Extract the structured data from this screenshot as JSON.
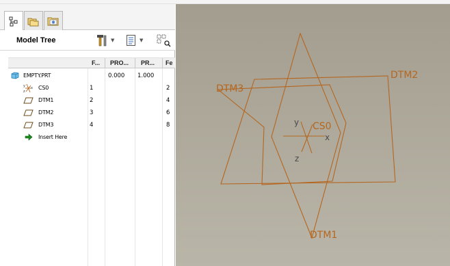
{
  "nav_tabs": [
    {
      "icon": "model-tree-tab-icon",
      "active": true
    },
    {
      "icon": "folder-browser-tab-icon",
      "active": false
    },
    {
      "icon": "favorites-tab-icon",
      "active": false
    }
  ],
  "model_tree": {
    "title": "Model Tree",
    "columns": [
      "F...",
      "PRO...",
      "PR...",
      "Fe"
    ],
    "rows": [
      {
        "label": "EMPTY.PRT",
        "icon": "part-icon",
        "c1": "",
        "c2": "0.000",
        "c3": "1.000",
        "c4": ""
      },
      {
        "label": "CS0",
        "icon": "coordinate-system-icon",
        "c1": "1",
        "c2": "",
        "c3": "",
        "c4": "2"
      },
      {
        "label": "DTM1",
        "icon": "datum-plane-icon",
        "c1": "2",
        "c2": "",
        "c3": "",
        "c4": "4"
      },
      {
        "label": "DTM2",
        "icon": "datum-plane-icon",
        "c1": "3",
        "c2": "",
        "c3": "",
        "c4": "6"
      },
      {
        "label": "DTM3",
        "icon": "datum-plane-icon",
        "c1": "4",
        "c2": "",
        "c3": "",
        "c4": "8"
      },
      {
        "label": "Insert Here",
        "icon": "insert-arrow-icon",
        "c1": "",
        "c2": "",
        "c3": "",
        "c4": ""
      }
    ]
  },
  "viewport": {
    "datum_labels": {
      "dtm1": "DTM1",
      "dtm2": "DTM2",
      "dtm3": "DTM3",
      "csys": "CS0"
    },
    "axis_labels": {
      "x": "x",
      "y": "y",
      "z": "z"
    },
    "datum_color": "#b5661f"
  }
}
